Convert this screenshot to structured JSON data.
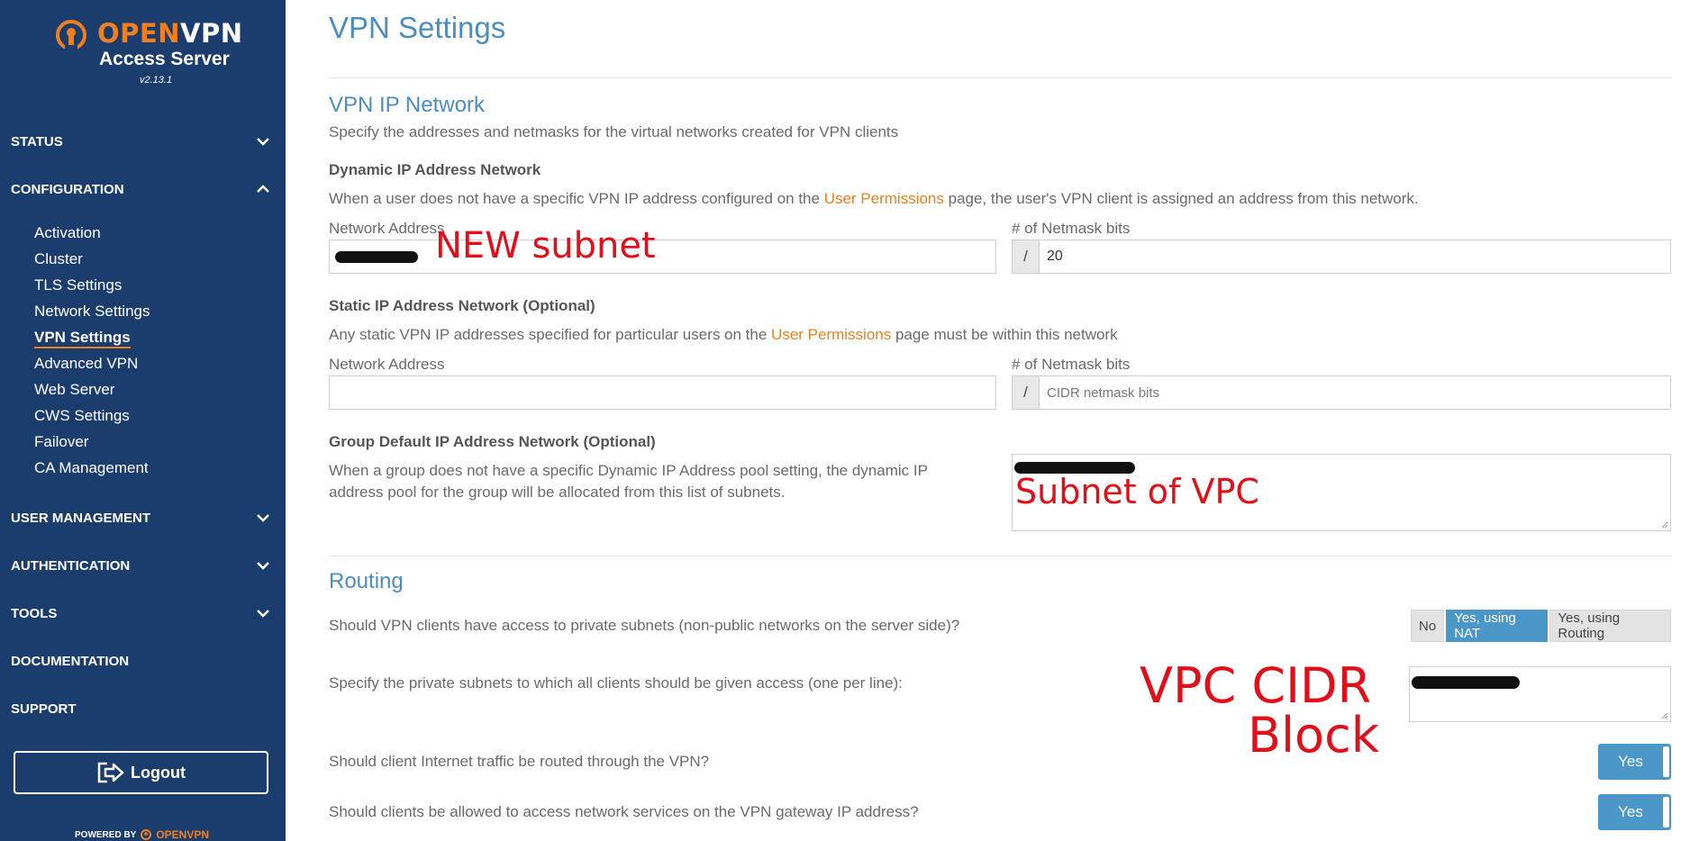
{
  "brand": {
    "open": "OPEN",
    "vpn": "VPN",
    "product": "Access Server",
    "version": "v2.13.1"
  },
  "sidebar": {
    "sections": [
      {
        "label": "STATUS"
      },
      {
        "label": "CONFIGURATION"
      },
      {
        "label": "USER  MANAGEMENT"
      },
      {
        "label": "AUTHENTICATION"
      },
      {
        "label": "TOOLS"
      },
      {
        "label": "DOCUMENTATION"
      },
      {
        "label": "SUPPORT"
      }
    ],
    "config_items": [
      "Activation",
      "Cluster",
      "TLS Settings",
      "Network Settings",
      "VPN Settings",
      "Advanced VPN",
      "Web Server",
      "CWS Settings",
      "Failover",
      "CA Management"
    ],
    "logout": "Logout",
    "powered_by": "POWERED BY",
    "powered_brand": "OPENVPN"
  },
  "page": {
    "title": "VPN Settings",
    "vpn_ip": {
      "heading": "VPN IP Network",
      "desc": "Specify the addresses and netmasks for the virtual networks created for VPN clients",
      "dynamic": {
        "title": "Dynamic IP Address Network",
        "desc_pre": "When a user does not have a specific VPN IP address configured on the ",
        "desc_link": "User Permissions",
        "desc_post": " page, the user's VPN client is assigned an address from this network.",
        "network_label": "Network Address",
        "netmask_label": "# of Netmask bits",
        "slash": "/",
        "netmask_value": "20"
      },
      "static": {
        "title": "Static IP Address Network (Optional)",
        "desc_pre": "Any static VPN IP addresses specified for particular users on the ",
        "desc_link": "User Permissions",
        "desc_post": " page must be within this network",
        "network_label": "Network Address",
        "netmask_label": "# of Netmask bits",
        "slash": "/",
        "netmask_placeholder": "CIDR netmask bits"
      },
      "group": {
        "title": "Group Default IP Address Network (Optional)",
        "desc_line1": "When a group does not have a specific Dynamic IP Address pool setting, the dynamic IP",
        "desc_line2": "address pool for the group will be allocated from this list of subnets."
      }
    },
    "routing": {
      "heading": "Routing",
      "q_private": "Should VPN clients have access to private subnets (non-public networks on the server side)?",
      "options": [
        "No",
        "Yes, using NAT",
        "Yes, using Routing"
      ],
      "selected_option": "Yes, using NAT",
      "q_subnets": "Specify the private subnets to which all clients should be given access (one per line):",
      "q_internet": "Should client Internet traffic be routed through the VPN?",
      "internet_toggle": "Yes",
      "q_gateway": "Should clients be allowed to access network services on the VPN gateway IP address?",
      "gateway_toggle": "Yes"
    },
    "annotations": {
      "new_subnet": "NEW subnet",
      "subnet_of_vpc": "Subnet of VPC",
      "vpc_cidr_line1": "VPC CIDR",
      "vpc_cidr_line2": "Block"
    }
  },
  "colors": {
    "sidebar": "#1b3d6e",
    "accent": "#4a8ec0",
    "link": "#e8801f",
    "toggle": "#4a97c8",
    "annotation": "#e0101a"
  }
}
